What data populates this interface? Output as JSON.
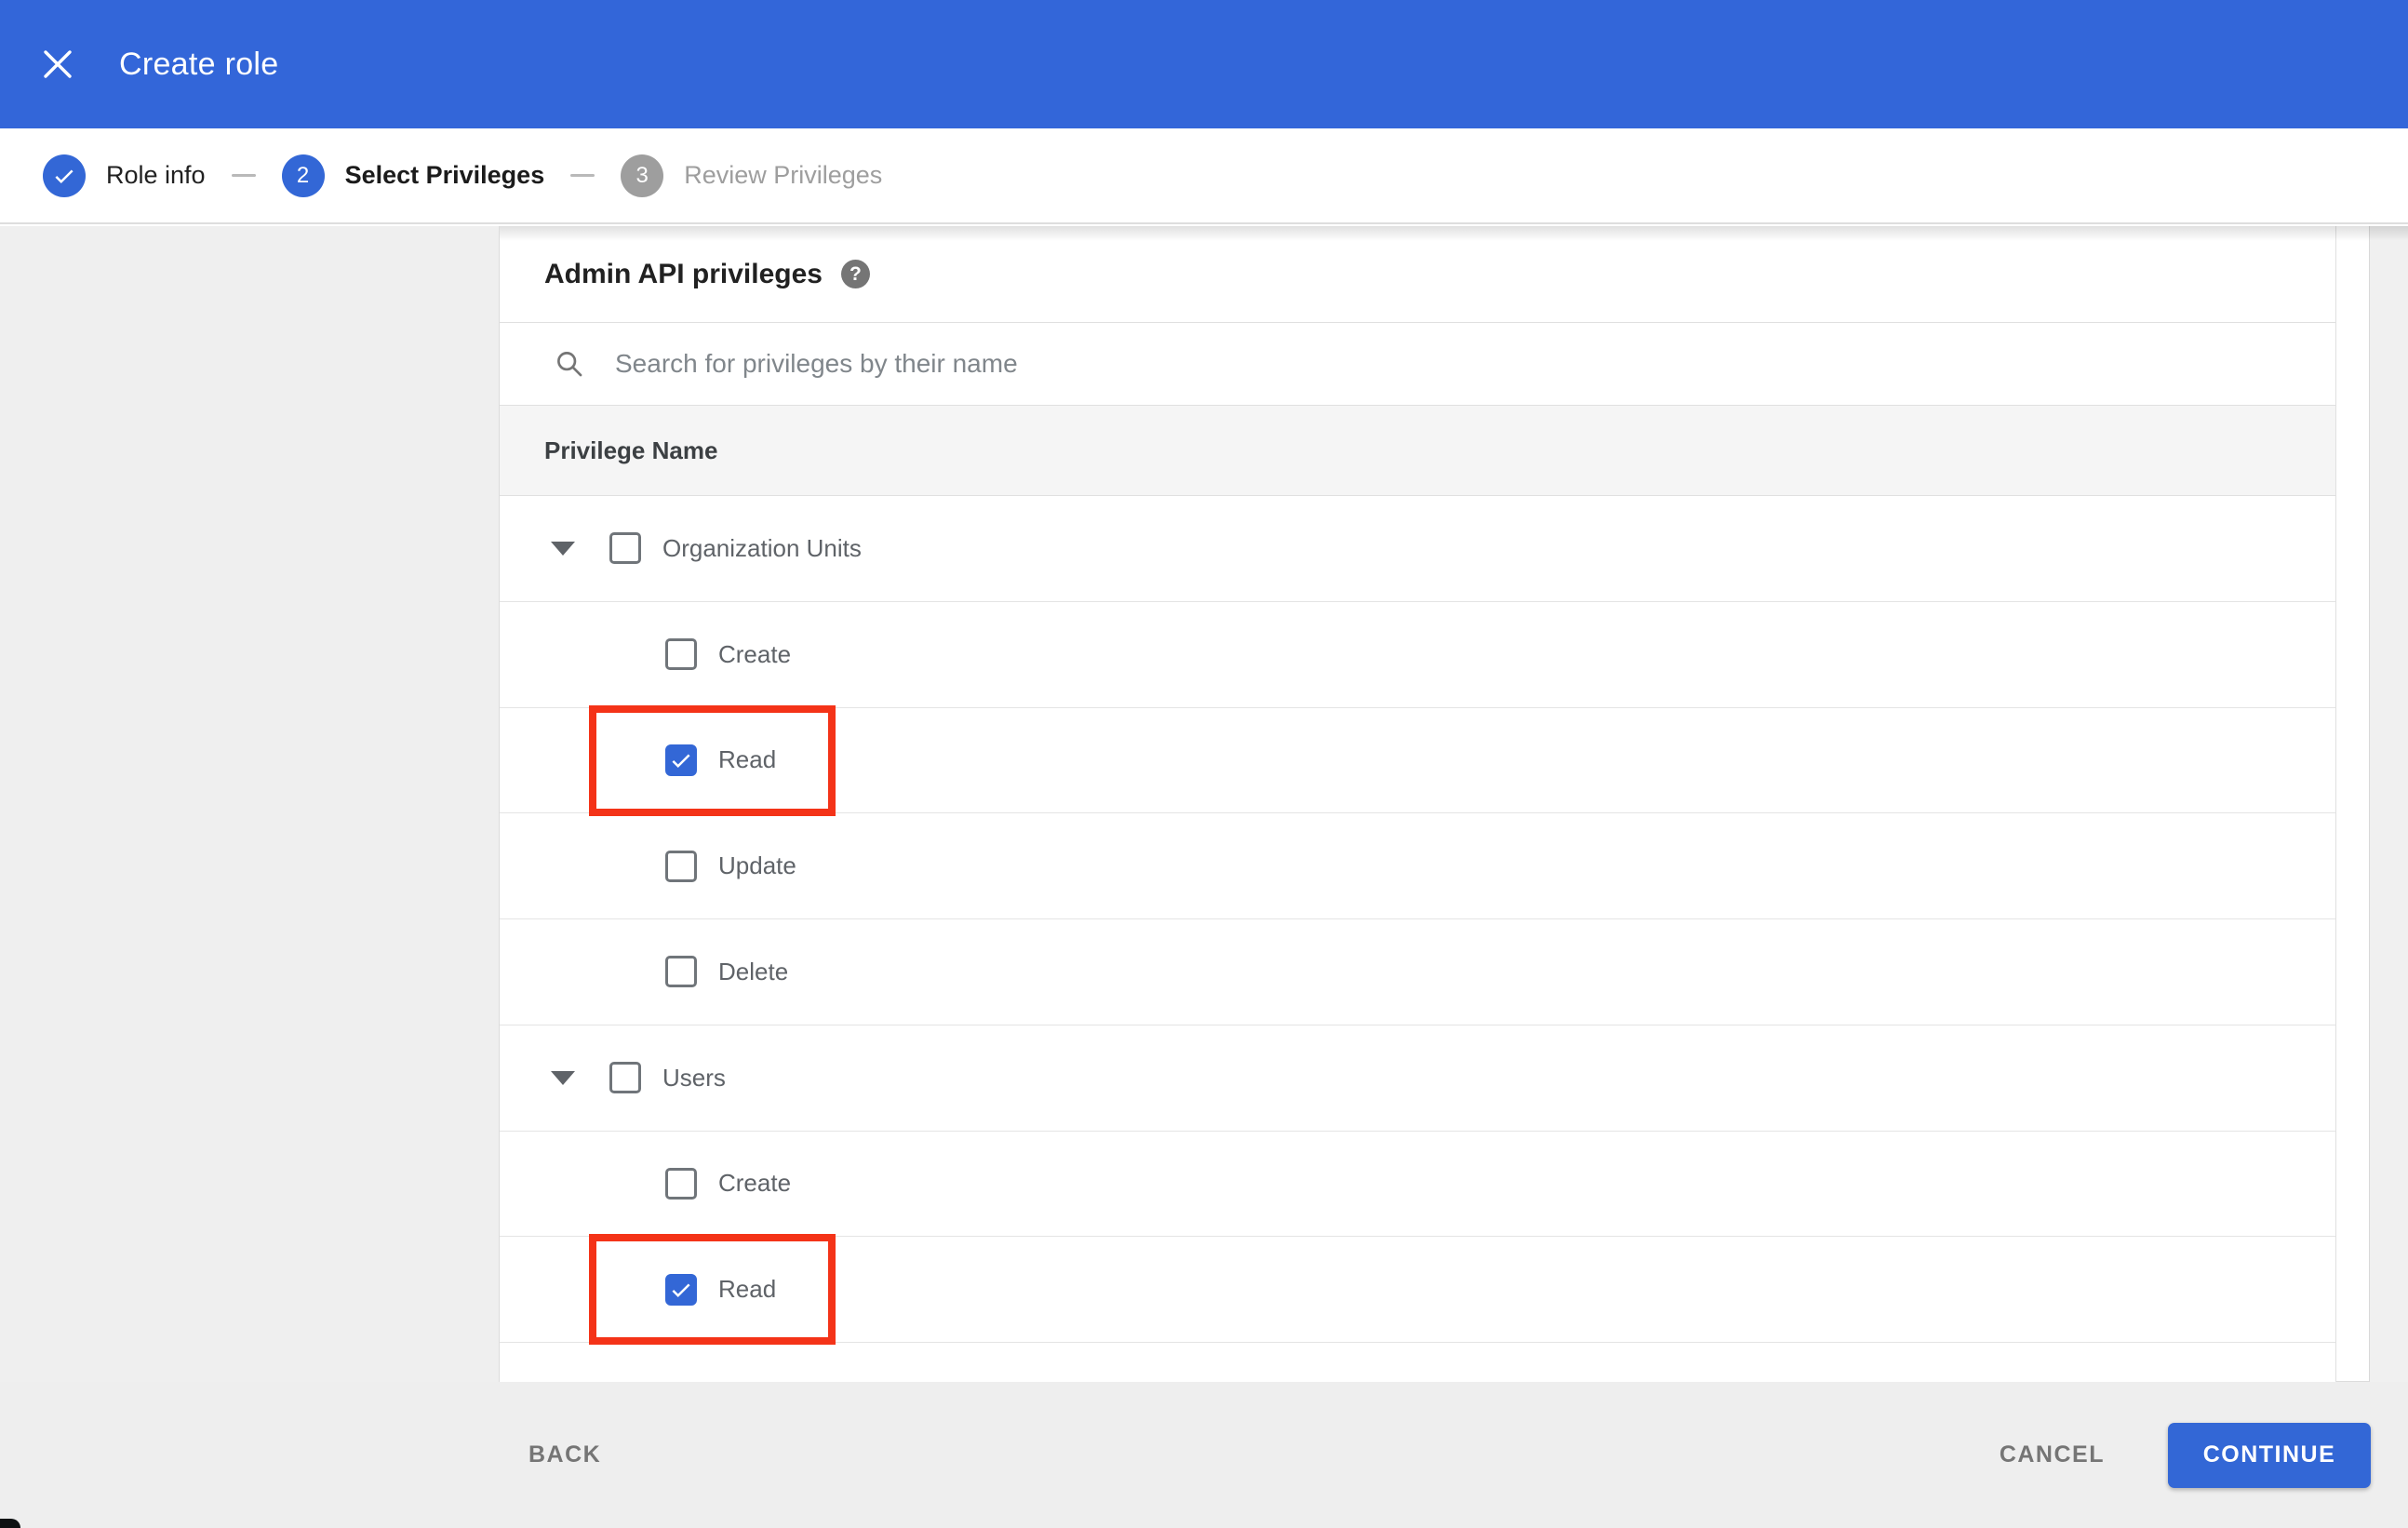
{
  "appbar": {
    "title": "Create role",
    "close_icon": "x"
  },
  "stepper": {
    "steps": [
      {
        "number": "1",
        "label": "Role info",
        "state": "completed",
        "icon": "check"
      },
      {
        "number": "2",
        "label": "Select Privileges",
        "state": "active"
      },
      {
        "number": "3",
        "label": "Review Privileges",
        "state": "upcoming"
      }
    ]
  },
  "content": {
    "heading": "Admin API privileges",
    "help_icon_glyph": "?",
    "search": {
      "placeholder": "Search for privileges by their name",
      "value": ""
    },
    "table": {
      "column_header": "Privilege Name",
      "rows": [
        {
          "type": "group",
          "label": "Organization Units",
          "checked": false,
          "highlighted": false,
          "expanded": true
        },
        {
          "type": "child",
          "label": "Create",
          "checked": false,
          "highlighted": false
        },
        {
          "type": "child",
          "label": "Read",
          "checked": true,
          "highlighted": true
        },
        {
          "type": "child",
          "label": "Update",
          "checked": false,
          "highlighted": false
        },
        {
          "type": "child",
          "label": "Delete",
          "checked": false,
          "highlighted": false
        },
        {
          "type": "group",
          "label": "Users",
          "checked": false,
          "highlighted": false,
          "expanded": true
        },
        {
          "type": "child",
          "label": "Create",
          "checked": false,
          "highlighted": false
        },
        {
          "type": "child",
          "label": "Read",
          "checked": true,
          "highlighted": true
        }
      ]
    }
  },
  "footer": {
    "back_label": "BACK",
    "cancel_label": "CANCEL",
    "continue_label": "CONTINUE"
  },
  "colors": {
    "app_bar_blue": "#3366d9",
    "accent_blue": "#3367d6",
    "highlight_red": "#f43318",
    "inactive_gray": "#9e9e9e",
    "pane_gray": "#efefef",
    "header_row_gray": "#f5f5f5"
  }
}
